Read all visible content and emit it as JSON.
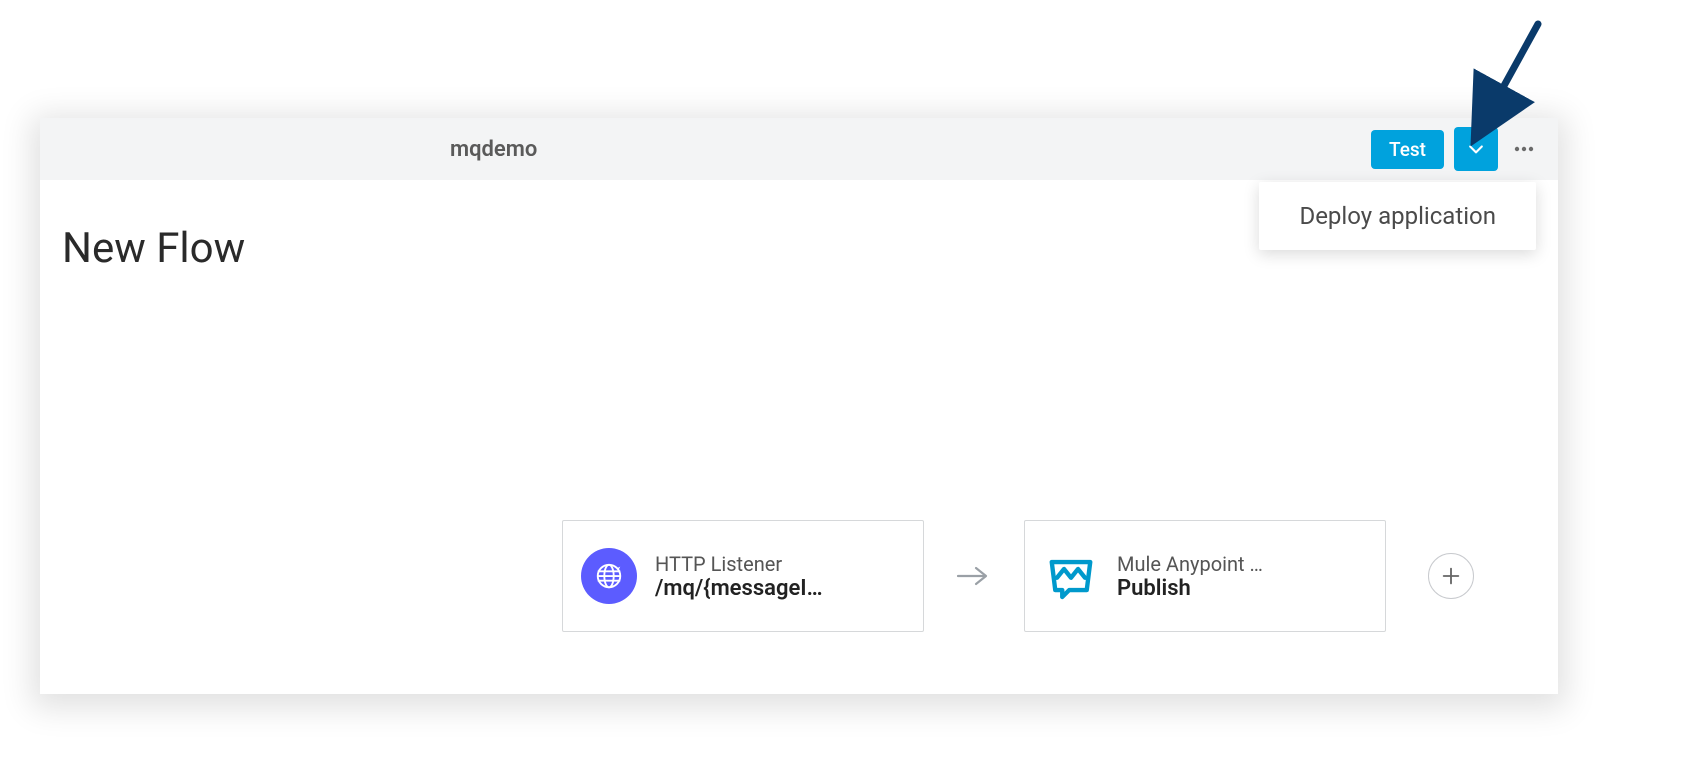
{
  "header": {
    "title": "mqdemo",
    "test_label": "Test"
  },
  "dropdown": {
    "deploy_label": "Deploy application"
  },
  "flow": {
    "title": "New Flow",
    "nodes": [
      {
        "type_label": "HTTP Listener",
        "value_label": "/mq/{messageI…"
      },
      {
        "type_label": "Mule Anypoint …",
        "value_label": "Publish"
      }
    ]
  }
}
